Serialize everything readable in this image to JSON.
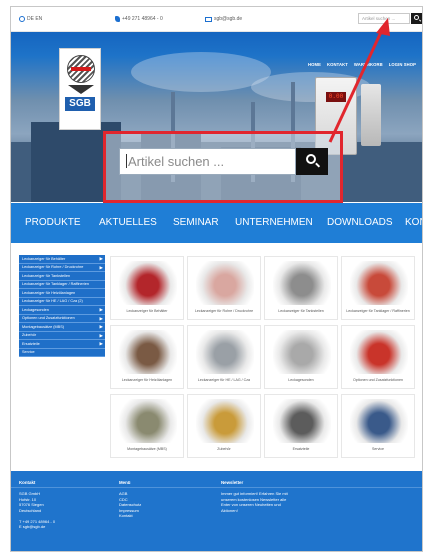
{
  "topbar": {
    "language": "DE EN",
    "phone": "+49 271 48964 - 0",
    "email": "sgb@sgb.de",
    "search_placeholder": "Artikel suchen ..."
  },
  "nav": [
    "HOME",
    "KONTAKT",
    "WARENKORB",
    "LOGIN SHOP"
  ],
  "logo_text": "SGB",
  "hero_search": {
    "placeholder": "Artikel suchen ...",
    "device_display": "0.00"
  },
  "categories": [
    "PRODUKTE",
    "AKTUELLES",
    "SEMINAR",
    "UNTERNEHMEN",
    "DOWNLOADS",
    "KONT"
  ],
  "sidebar": [
    {
      "label": "Leckanzeiger für Behälter",
      "has_sub": true
    },
    {
      "label": "Leckanzeiger für Rohre / Druckrohre",
      "has_sub": true
    },
    {
      "label": "Leckanzeiger für Tankstellen",
      "has_sub": false
    },
    {
      "label": "Leckanzeiger für Tanklager / Raffinerien",
      "has_sub": false
    },
    {
      "label": "Leckanzeiger für Heizölanlagen",
      "has_sub": false
    },
    {
      "label": "Leckanzeiger für HE / LAG / Cza (2)",
      "has_sub": false
    },
    {
      "label": "Leckagesonden",
      "has_sub": true
    },
    {
      "label": "Optionen und Zusatzfunktionen",
      "has_sub": true
    },
    {
      "label": "Montagebausätze (MBS)",
      "has_sub": true
    },
    {
      "label": "Zubehör",
      "has_sub": true
    },
    {
      "label": "Ersatzteile",
      "has_sub": true
    },
    {
      "label": "Service",
      "has_sub": false
    }
  ],
  "products": [
    {
      "caption": "Leckanzeiger für Behälter",
      "color": "#b3262b"
    },
    {
      "caption": "Leckanzeiger für Rohre / Druckrohre",
      "color": "#d9a7a0"
    },
    {
      "caption": "Leckanzeiger für Tankstellen",
      "color": "#8d8d8d"
    },
    {
      "caption": "Leckanzeiger für Tanklager / Raffinerien",
      "color": "#c84a3a"
    },
    {
      "caption": "Leckanzeiger für Heizölanlagen",
      "color": "#7a5a44"
    },
    {
      "caption": "Leckanzeiger für HE / LAG / Cza",
      "color": "#9aa0a6"
    },
    {
      "caption": "Leckagesonden",
      "color": "#a9a9a9"
    },
    {
      "caption": "Optionen und Zusatzfunktionen",
      "color": "#c9342a"
    },
    {
      "caption": "Montagebausätze (MBS)",
      "color": "#8a8a70"
    },
    {
      "caption": "Zubehör",
      "color": "#c99b3a"
    },
    {
      "caption": "Ersatzteile",
      "color": "#5c5c5c"
    },
    {
      "caption": "Service",
      "color": "#3a5a8a"
    }
  ],
  "footer": {
    "col1_title": "Kontakt",
    "col1": [
      "SGB GmbH",
      "Hofstr. 10",
      "57076 Siegen",
      "Deutschland",
      "",
      "T +49 271 48964 - 0",
      "E sgb@sgb.de"
    ],
    "col2_title": "Menü",
    "col2": [
      "AGB",
      "CDC",
      "Datenschutz",
      "Impressum",
      "Kontakt"
    ],
    "col3_title": "Newsletter",
    "col3": [
      "Immer gut informiert! Erfahren Sie mit",
      "unserem kostenlosen Newsletter alle",
      "Enter von unseren Neuheiten und",
      "Aktionen!"
    ]
  },
  "colors": {
    "brand_blue": "#1f74cc",
    "highlight_red": "#e1262d"
  }
}
